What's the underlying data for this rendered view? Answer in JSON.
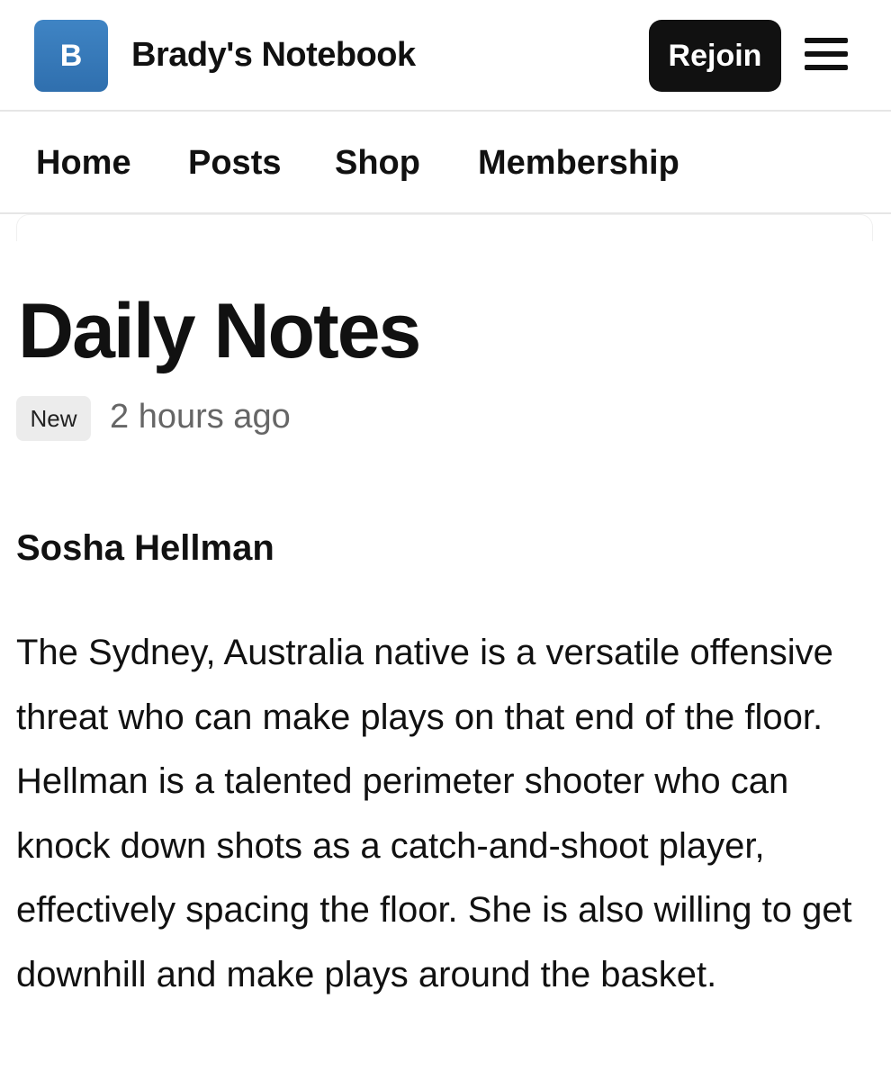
{
  "header": {
    "logo_letter": "B",
    "site_title": "Brady's Notebook",
    "rejoin_label": "Rejoin",
    "menu_icon": "hamburger-menu-icon",
    "logo_color": "#3a7cbd"
  },
  "nav": {
    "items": [
      "Home",
      "Posts",
      "Shop",
      "Membership"
    ]
  },
  "post": {
    "title": "Daily Notes",
    "badge": "New",
    "timestamp": "2 hours ago",
    "author": "Sosha Hellman",
    "body": "The Sydney, Australia native is a versatile offensive threat who can make plays on that end of the floor. Hellman is a talented perimeter shooter who can knock down shots as a catch-and-shoot player, effectively spacing the floor. She is also willing to get downhill and make plays around the basket."
  }
}
